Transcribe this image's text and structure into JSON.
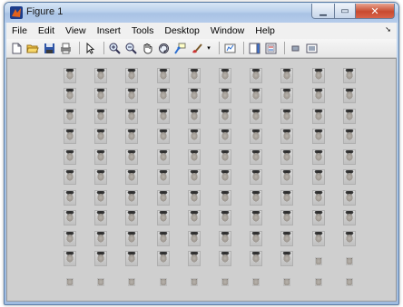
{
  "window": {
    "title": "Figure 1",
    "buttons": {
      "minimize_icon": "minimize-icon",
      "maximize_icon": "maximize-icon",
      "close_icon": "close-icon"
    }
  },
  "menubar": {
    "items": [
      "File",
      "Edit",
      "View",
      "Insert",
      "Tools",
      "Desktop",
      "Window",
      "Help"
    ]
  },
  "toolbar": {
    "icons": [
      "new-figure-icon",
      "open-file-icon",
      "save-icon",
      "print-icon",
      "edit-plot-arrow-icon",
      "zoom-in-icon",
      "zoom-out-icon",
      "pan-hand-icon",
      "rotate-3d-icon",
      "data-cursor-icon",
      "brush-icon",
      "link-plot-icon",
      "colorbar-icon",
      "legend-icon",
      "hide-plot-tools-icon",
      "show-plot-tools-icon"
    ]
  },
  "figure": {
    "grid_rows": 11,
    "grid_cols": 10,
    "full_rows": 9,
    "row10_full_cells": 8,
    "background_color": "#cfcfcf"
  }
}
